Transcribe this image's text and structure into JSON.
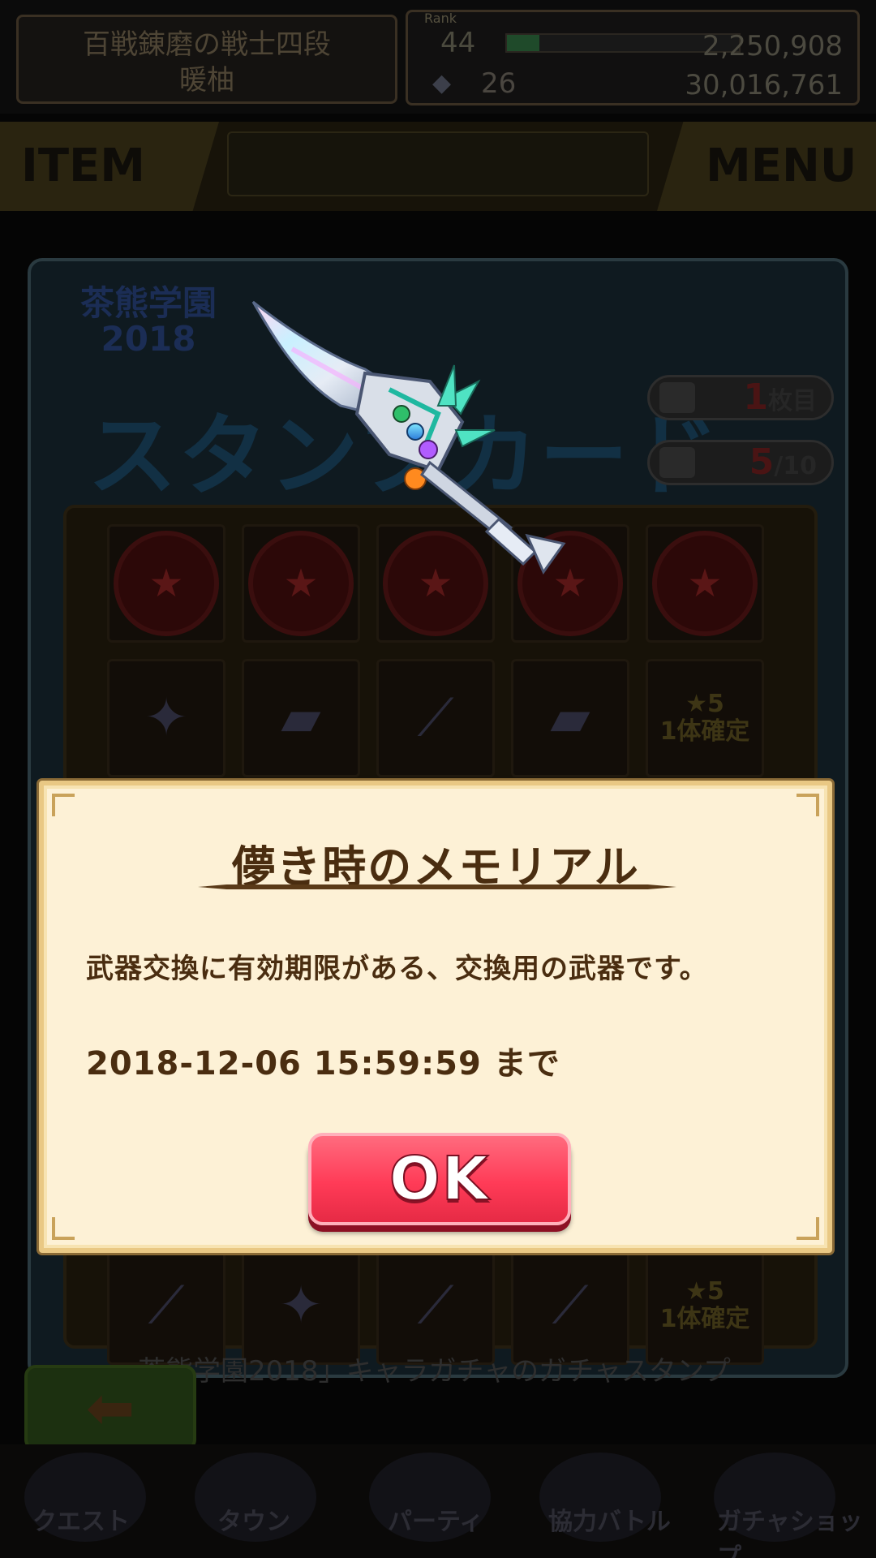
{
  "header": {
    "player_title": "百戦錬磨の戦士四段",
    "player_name": "暖柚",
    "rank_label": "Rank",
    "rank": "44",
    "stamina": "2,250,908",
    "gems": "26",
    "money": "30,016,761"
  },
  "tabs": {
    "item": "ITEM",
    "menu": "MENU"
  },
  "stamp_card": {
    "event_logo": "茶熊学園2018",
    "title": "スタンプカード",
    "sheet_number": "1",
    "sheet_suffix": "枚目",
    "stamp_count": "5",
    "stamp_total": "/10",
    "row1_icon": "stamp-collected",
    "row2_rewards": [
      "star-crystal",
      "book",
      "weapon",
      "book",
      "star5-guarantee"
    ],
    "star5_label": "1体確定",
    "gacha_caption": "茶熊学園2018」キャラガチャのガチャスタンプ"
  },
  "navigation": [
    "クエスト",
    "タウン",
    "パーティ",
    "協力バトル",
    "ガチャショップ"
  ],
  "dialog": {
    "title": "儚き時のメモリアル",
    "description": "武器交換に有効期限がある、交換用の武器です。",
    "expiry": "2018-12-06  15:59:59  まで",
    "ok_label": "OK"
  },
  "colors": {
    "ok_button": "#ff3b57",
    "dialog_bg": "#fdf1d6",
    "dialog_text": "#4a2d10"
  }
}
